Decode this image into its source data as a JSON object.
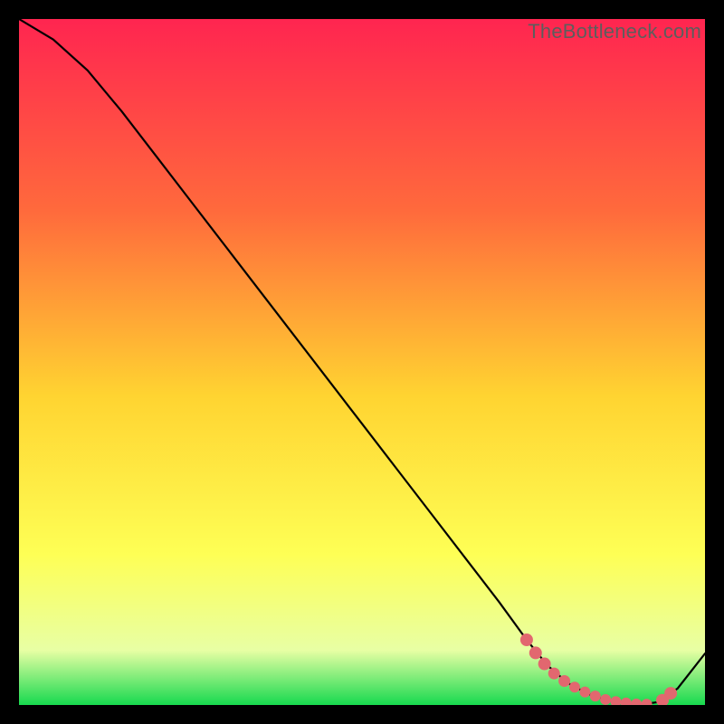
{
  "watermark": "TheBottleneck.com",
  "colors": {
    "bg": "#000000",
    "grad_top": "#ff2550",
    "grad_upper": "#ff6a3c",
    "grad_mid": "#ffd431",
    "grad_low1": "#feff55",
    "grad_low2": "#e8ffa4",
    "grad_bottom": "#17d94f",
    "curve": "#000000",
    "marker": "#e2676f"
  },
  "chart_data": {
    "type": "line",
    "title": "",
    "xlabel": "",
    "ylabel": "",
    "xlim": [
      0,
      100
    ],
    "ylim": [
      0,
      100
    ],
    "series": [
      {
        "name": "curve",
        "x": [
          0,
          5,
          10,
          15,
          20,
          25,
          30,
          35,
          40,
          45,
          50,
          55,
          60,
          65,
          70,
          74,
          77,
          80,
          83,
          86,
          89,
          91,
          93,
          96,
          100
        ],
        "y": [
          100,
          97,
          92.5,
          86.5,
          80,
          73.5,
          67,
          60.5,
          54,
          47.5,
          41,
          34.5,
          28,
          21.5,
          15,
          9.5,
          5.8,
          3.2,
          1.6,
          0.6,
          0.15,
          0.1,
          0.4,
          2.4,
          7.5
        ]
      }
    ],
    "markers": {
      "name": "highlight",
      "x": [
        74.0,
        75.3,
        76.6,
        78.0,
        79.5,
        81.0,
        82.5,
        84.0,
        85.5,
        87.0,
        88.5,
        90.0,
        91.5,
        93.8,
        95.0
      ],
      "y": [
        9.5,
        7.6,
        6.0,
        4.6,
        3.5,
        2.6,
        1.9,
        1.3,
        0.8,
        0.5,
        0.3,
        0.15,
        0.12,
        0.7,
        1.7
      ],
      "r": [
        7,
        7,
        7,
        6.5,
        6.5,
        6,
        6,
        6,
        6,
        6,
        6,
        6,
        6,
        7,
        7
      ]
    }
  }
}
